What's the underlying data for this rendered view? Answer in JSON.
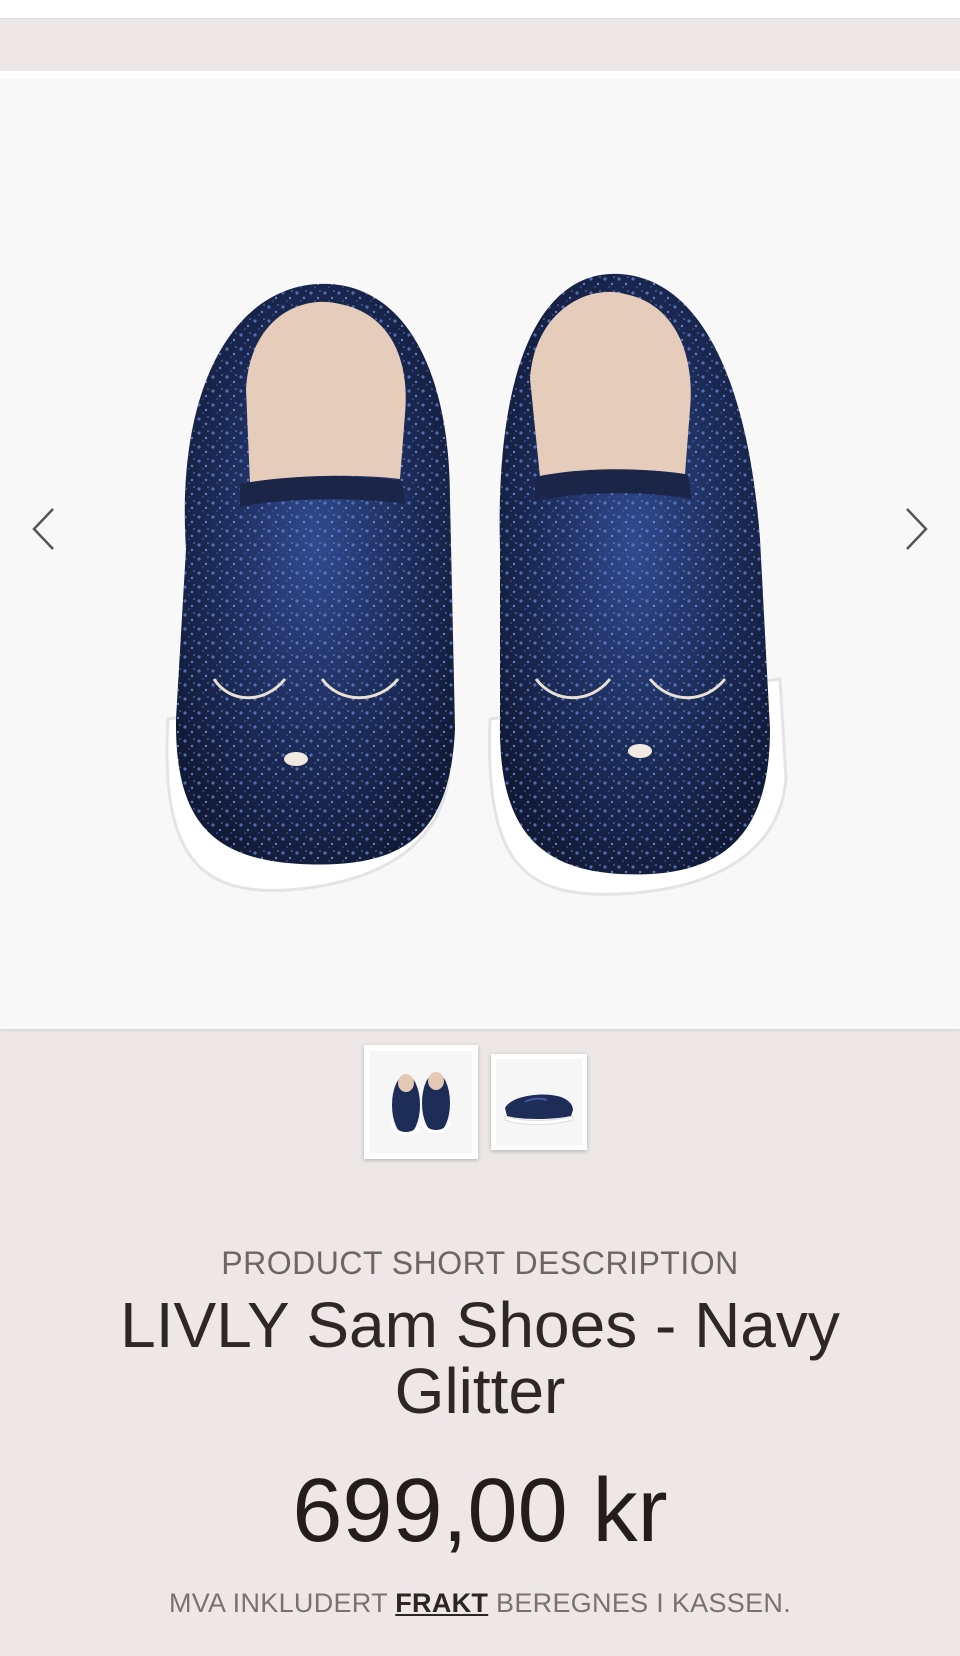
{
  "header": {},
  "gallery": {
    "prev_icon": "chevron-left-icon",
    "next_icon": "chevron-right-icon",
    "image_label": "Navy glitter slip-on shoes, top view",
    "thumbnails": [
      {
        "label": "Top view thumbnail",
        "selected": true
      },
      {
        "label": "Side view thumbnail",
        "selected": false
      }
    ]
  },
  "product": {
    "kicker": "PRODUCT SHORT DESCRIPTION",
    "title": "LIVLY Sam Shoes - Navy Glitter",
    "price": "699,00 kr",
    "tax_note_prefix": "MVA INKLUDERT",
    "shipping_link": "FRAKT",
    "tax_note_suffix": "BEREGNES I KASSEN."
  },
  "colors": {
    "page_bg": "#ede8e7",
    "hero_bg": "#f8f8f9",
    "navy": "#1b2a52",
    "sole": "#ffffff"
  }
}
